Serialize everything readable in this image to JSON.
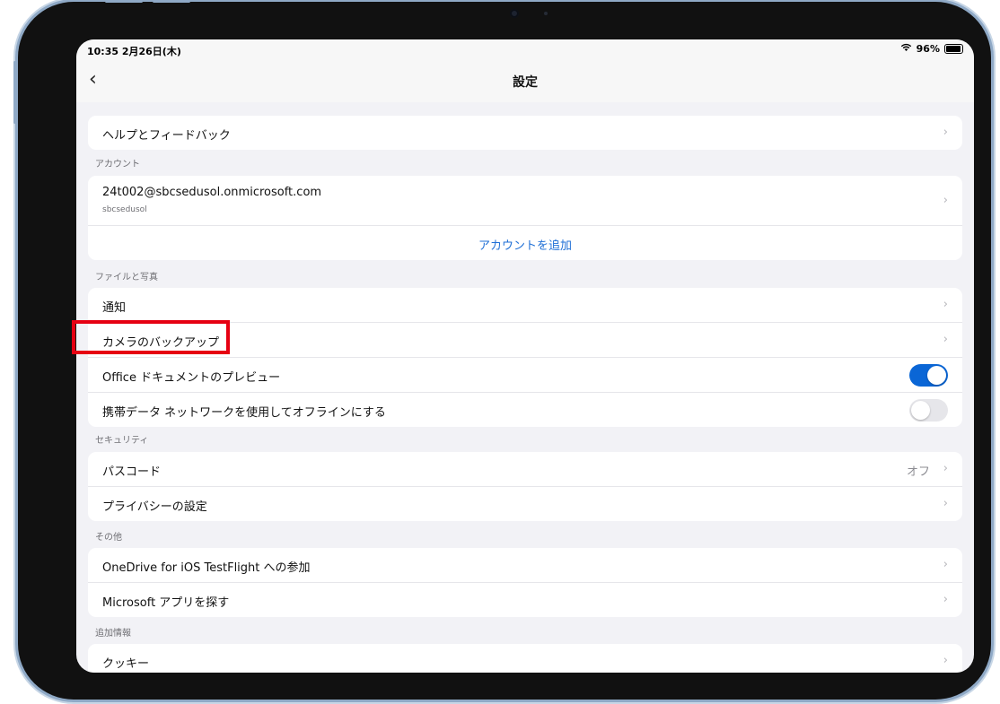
{
  "status": {
    "time": "10:35  2月26日(木)",
    "battery": "96%",
    "wifi_icon": "wifi-icon"
  },
  "nav": {
    "title": "設定",
    "back_icon": "chevron-left-icon"
  },
  "help": {
    "label": "ヘルプとフィードバック"
  },
  "account": {
    "header": "アカウント",
    "email": "24t002@sbcsedusol.onmicrosoft.com",
    "org": "sbcsedusol",
    "add_label": "アカウントを追加"
  },
  "files": {
    "header": "ファイルと写真",
    "notifications": "通知",
    "camera_backup": "カメラのバックアップ",
    "office_preview": "Office ドキュメントのプレビュー",
    "office_preview_on": true,
    "offline_cellular": "携帯データ ネットワークを使用してオフラインにする",
    "offline_cellular_on": false
  },
  "security": {
    "header": "セキュリティ",
    "passcode": "パスコード",
    "passcode_value": "オフ",
    "privacy": "プライバシーの設定"
  },
  "other": {
    "header": "その他",
    "testflight": "OneDrive for iOS TestFlight への参加",
    "find_apps": "Microsoft アプリを探す"
  },
  "more_info": {
    "header": "追加情報",
    "cookies": "クッキー"
  },
  "colors": {
    "accent": "#0a66d6",
    "highlight": "#e60012"
  }
}
